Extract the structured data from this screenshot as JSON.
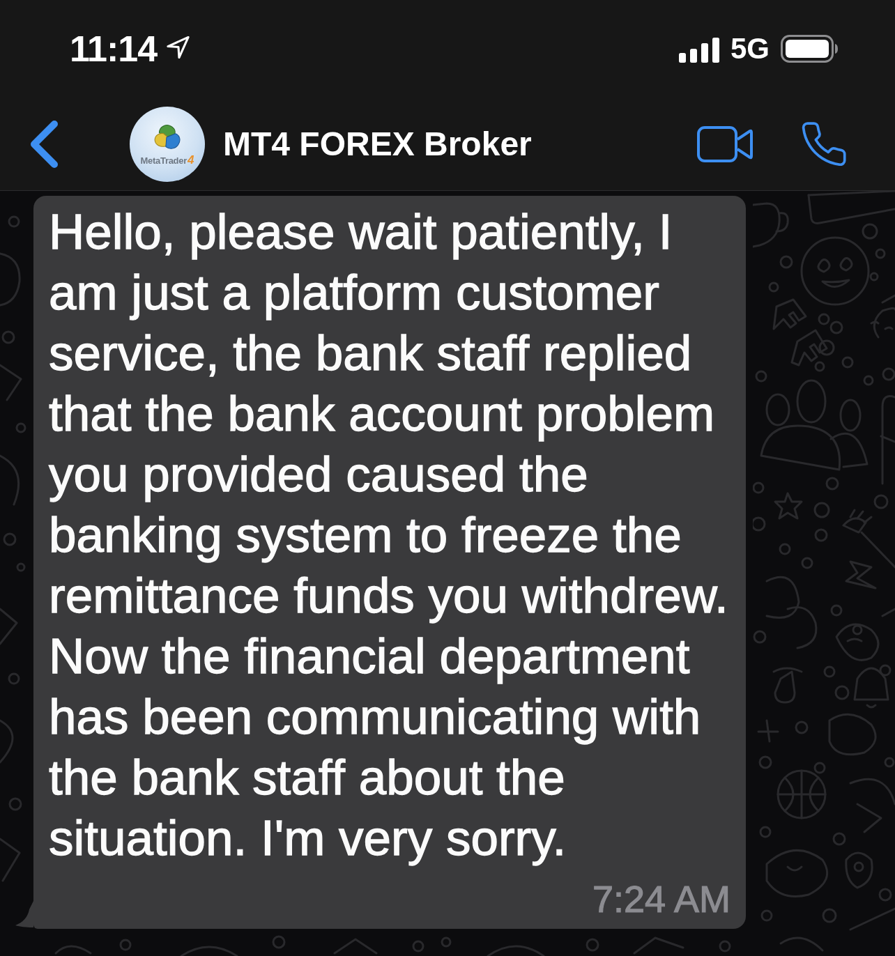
{
  "status_bar": {
    "time": "11:14",
    "network": "5G"
  },
  "header": {
    "title": "MT4 FOREX Broker",
    "avatar": {
      "logo_text": "MetaTrader",
      "logo_number": "4"
    }
  },
  "messages": [
    {
      "kind": "incoming",
      "text": "Hello, please wait patiently, I am just a platform customer service, the bank staff replied that the bank account problem you provided caused the banking system to freeze the remittance funds you withdrew. Now the financial department has been communicating with the bank staff about the situation. I'm very sorry.",
      "time": "7:24 AM"
    }
  ]
}
